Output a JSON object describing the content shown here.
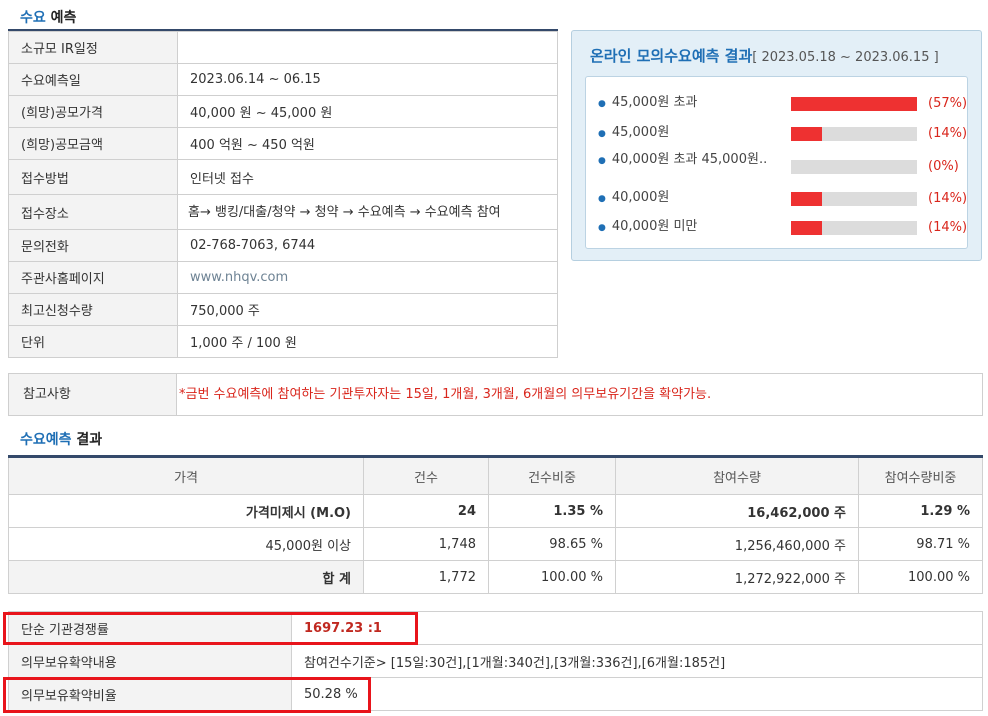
{
  "demand": {
    "title_part1": "수요",
    "title_part2": "예측",
    "rows": [
      {
        "label": "소규모 IR일정",
        "value": ""
      },
      {
        "label": "수요예측일",
        "value": "2023.06.14 ~ 06.15"
      },
      {
        "label": "(희망)공모가격",
        "value": "40,000 원 ~ 45,000 원"
      },
      {
        "label": "(희망)공모금액",
        "value": "400 억원 ~ 450 억원"
      },
      {
        "label": "접수방법",
        "value": "인터넷 접수"
      },
      {
        "label": "접수장소",
        "value": "홈→ 뱅킹/대출/청약 → 청약 → 수요예측 → 수요예측 참여"
      },
      {
        "label": "문의전화",
        "value": "02-768-7063, 6744"
      },
      {
        "label": "주관사홈페이지",
        "value": "www.nhqv.com"
      },
      {
        "label": "최고신청수량",
        "value": "750,000 주"
      },
      {
        "label": "단위",
        "value": "1,000 주 / 100 원"
      }
    ]
  },
  "online": {
    "title": "온라인 모의수요예측 결과",
    "date_range": "[ 2023.05.18 ~ 2023.06.15 ]",
    "items": [
      {
        "label": "45,000원 초과",
        "percent": 57,
        "percent_label": "(57%)"
      },
      {
        "label": "45,000원",
        "percent": 14,
        "percent_label": "(14%)"
      },
      {
        "label": "40,000원 초과 45,000원..",
        "percent": 0,
        "percent_label": "(0%)"
      },
      {
        "label": "40,000원",
        "percent": 14,
        "percent_label": "(14%)"
      },
      {
        "label": "40,000원 미만",
        "percent": 14,
        "percent_label": "(14%)"
      }
    ],
    "bar_color": "#ee3131"
  },
  "note": {
    "label": "참고사항",
    "value": "*금번 수요예측에 참여하는 기관투자자는 15일, 1개월, 3개월, 6개월의 의무보유기간을 확약가능."
  },
  "result": {
    "title_part1": "수요예측",
    "title_part2": "결과",
    "headers": [
      "가격",
      "건수",
      "건수비중",
      "참여수량",
      "참여수량비중"
    ],
    "rows": [
      [
        "가격미제시 (M.O)",
        "24",
        "1.35 %",
        "16,462,000 주",
        "1.29 %"
      ],
      [
        "45,000원 이상",
        "1,748",
        "98.65 %",
        "1,256,460,000 주",
        "98.71 %"
      ],
      [
        "합 계",
        "1,772",
        "100.00 %",
        "1,272,922,000 주",
        "100.00 %"
      ]
    ]
  },
  "bottom": {
    "rows": [
      {
        "label": "단순 기관경쟁률",
        "value": "1697.23 :1"
      },
      {
        "label": "의무보유확약내용",
        "value": "참여건수기준> [15일:30건],[1개월:340건],[3개월:336건],[6개월:185건]"
      },
      {
        "label": "의무보유확약비율",
        "value": "50.28 %"
      }
    ]
  },
  "colors": {
    "accent_blue": "#1f6fb5",
    "highlight_red": "#e8141b",
    "header_rule": "#34496a"
  }
}
